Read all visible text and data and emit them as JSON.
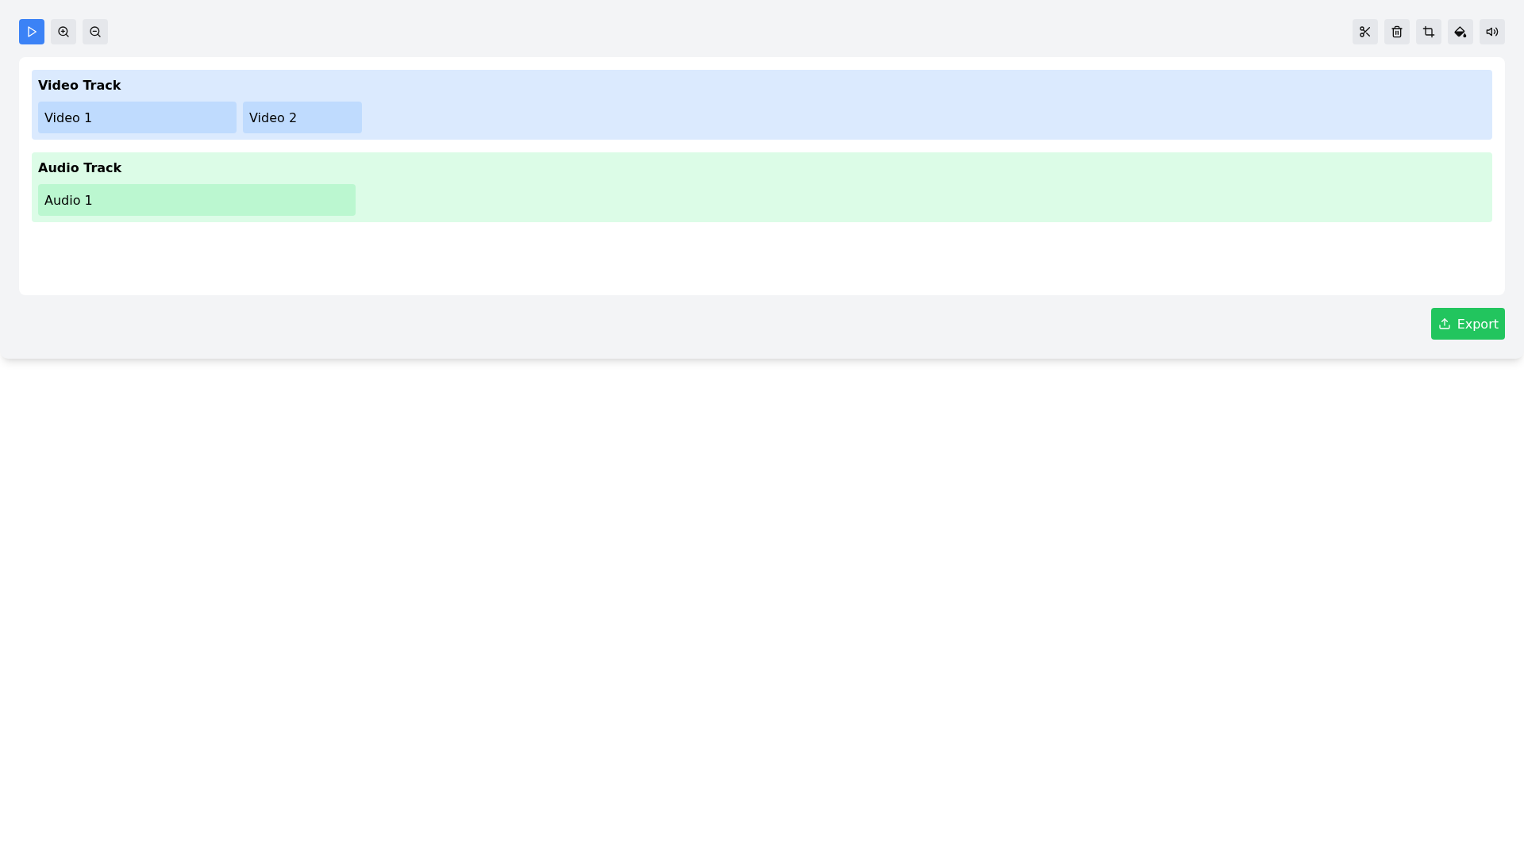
{
  "tracks": [
    {
      "kind": "video",
      "title": "Video Track",
      "clips": [
        {
          "label": "Video 1"
        },
        {
          "label": "Video 2"
        }
      ]
    },
    {
      "kind": "audio",
      "title": "Audio Track",
      "clips": [
        {
          "label": "Audio 1"
        }
      ]
    }
  ],
  "export_button": {
    "label": "Export"
  }
}
